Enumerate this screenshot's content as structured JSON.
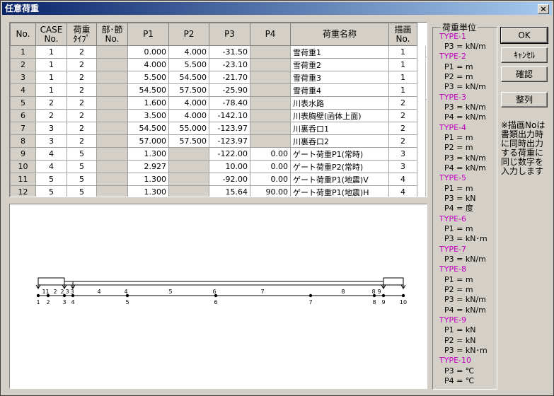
{
  "window": {
    "title": "任意荷重",
    "close_label": "×"
  },
  "table": {
    "headers": [
      "No.",
      "CASE\nNo.",
      "荷重\nﾀｲﾌﾟ",
      "部･節\nNo.",
      "P1",
      "P2",
      "P3",
      "P4",
      "荷重名称",
      "描画\nNo."
    ],
    "rows": [
      [
        "1",
        "1",
        "2",
        "",
        "0.000",
        "4.000",
        "-31.50",
        "",
        "雪荷重1",
        "1"
      ],
      [
        "2",
        "1",
        "2",
        "",
        "4.000",
        "5.500",
        "-23.10",
        "",
        "雪荷重2",
        "1"
      ],
      [
        "3",
        "1",
        "2",
        "",
        "5.500",
        "54.500",
        "-21.70",
        "",
        "雪荷重3",
        "1"
      ],
      [
        "4",
        "1",
        "2",
        "",
        "54.500",
        "57.500",
        "-25.90",
        "",
        "雪荷重4",
        "1"
      ],
      [
        "5",
        "2",
        "2",
        "",
        "1.600",
        "4.000",
        "-78.40",
        "",
        "川表水路",
        "2"
      ],
      [
        "6",
        "2",
        "2",
        "",
        "3.500",
        "4.000",
        "-142.10",
        "",
        "川表胸壁(函体上面)",
        "2"
      ],
      [
        "7",
        "3",
        "2",
        "",
        "54.500",
        "55.000",
        "-123.97",
        "",
        "川裏呑口1",
        "2"
      ],
      [
        "8",
        "3",
        "2",
        "",
        "57.000",
        "57.500",
        "-123.97",
        "",
        "川裏呑口2",
        "2"
      ],
      [
        "9",
        "4",
        "5",
        "",
        "1.300",
        "",
        "-122.00",
        "0.00",
        "ゲート荷重P1(常時)",
        "3"
      ],
      [
        "10",
        "4",
        "5",
        "",
        "2.927",
        "",
        "10.00",
        "0.00",
        "ゲート荷重P2(常時)",
        "3"
      ],
      [
        "11",
        "5",
        "5",
        "",
        "1.300",
        "",
        "-92.00",
        "0.00",
        "ゲート荷重P1(地震)V",
        "4"
      ],
      [
        "12",
        "5",
        "5",
        "",
        "1.300",
        "",
        "15.64",
        "90.00",
        "ゲート荷重P1(地震)H",
        "4"
      ]
    ]
  },
  "diagram": {
    "member_labels": [
      "1",
      "1",
      "2",
      "2",
      "3",
      "3",
      "4",
      "4",
      "5",
      "6",
      "7",
      "8",
      "8",
      "9"
    ],
    "node_labels": [
      "1",
      "2",
      "3",
      "4",
      "5",
      "6",
      "7",
      "8",
      "9",
      "10"
    ]
  },
  "units": {
    "title": "荷重単位",
    "lines": [
      {
        "text": "TYPE-1",
        "type": true
      },
      {
        "text": "P3 = kN/m",
        "type": false
      },
      {
        "text": "TYPE-2",
        "type": true
      },
      {
        "text": "P1 = m",
        "type": false
      },
      {
        "text": "P2 = m",
        "type": false
      },
      {
        "text": "P3 = kN/m",
        "type": false
      },
      {
        "text": "TYPE-3",
        "type": true
      },
      {
        "text": "P3 = kN/m",
        "type": false
      },
      {
        "text": "P4 = kN/m",
        "type": false
      },
      {
        "text": "TYPE-4",
        "type": true
      },
      {
        "text": "P1 = m",
        "type": false
      },
      {
        "text": "P2 = m",
        "type": false
      },
      {
        "text": "P3 = kN/m",
        "type": false
      },
      {
        "text": "P4 = kN/m",
        "type": false
      },
      {
        "text": "TYPE-5",
        "type": true
      },
      {
        "text": "P1 = m",
        "type": false
      },
      {
        "text": "P3 = kN",
        "type": false
      },
      {
        "text": "P4 = 度",
        "type": false
      },
      {
        "text": "TYPE-6",
        "type": true
      },
      {
        "text": "P1 = m",
        "type": false
      },
      {
        "text": "P3 = kN･m",
        "type": false
      },
      {
        "text": "TYPE-7",
        "type": true
      },
      {
        "text": "P3 = kN/m",
        "type": false
      },
      {
        "text": "TYPE-8",
        "type": true
      },
      {
        "text": "P1 = m",
        "type": false
      },
      {
        "text": "P2 = m",
        "type": false
      },
      {
        "text": "P3 = kN/m",
        "type": false
      },
      {
        "text": "P4 = kN/m",
        "type": false
      },
      {
        "text": "TYPE-9",
        "type": true
      },
      {
        "text": "P1 = kN",
        "type": false
      },
      {
        "text": "P2 = kN",
        "type": false
      },
      {
        "text": "P3 = kN･m",
        "type": false
      },
      {
        "text": "TYPE-10",
        "type": true
      },
      {
        "text": "P3 = ℃",
        "type": false
      },
      {
        "text": "P4 = ℃",
        "type": false
      }
    ]
  },
  "buttons": {
    "ok": "OK",
    "cancel": "ｷｬﾝｾﾙ",
    "confirm": "確認",
    "sort": "整列"
  },
  "note": "※描画Noは書類出力時に同時出力する荷重に同じ数字を入力します",
  "colors": {
    "title_start": "#0a246a",
    "title_end": "#a6caf0",
    "face": "#d4d0c8",
    "type_label": "#c000c0"
  },
  "icons": {
    "close": "close-icon",
    "scroll_up": "arrow-up-icon",
    "scroll_down": "arrow-down-icon"
  }
}
